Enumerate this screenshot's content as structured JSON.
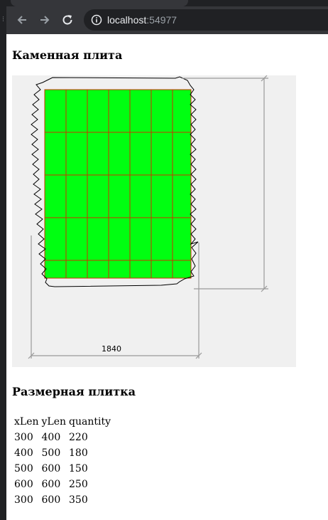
{
  "browser": {
    "url_host": "localhost",
    "url_port": ":54977"
  },
  "page": {
    "stone_heading": "Каменная плита",
    "tiles_heading": "Размерная плитка"
  },
  "drawing": {
    "width_dimension_label": "1840"
  },
  "tiles_table": {
    "columns": [
      "xLen",
      "yLen",
      "quantity"
    ],
    "rows": [
      [
        "300",
        "400",
        "220"
      ],
      [
        "400",
        "500",
        "180"
      ],
      [
        "500",
        "600",
        "150"
      ],
      [
        "600",
        "600",
        "250"
      ],
      [
        "300",
        "600",
        "350"
      ]
    ]
  },
  "colors": {
    "tile_fill": "#00ff11",
    "tile_grid": "#cc3300",
    "panel_background": "#f0f0f0"
  }
}
